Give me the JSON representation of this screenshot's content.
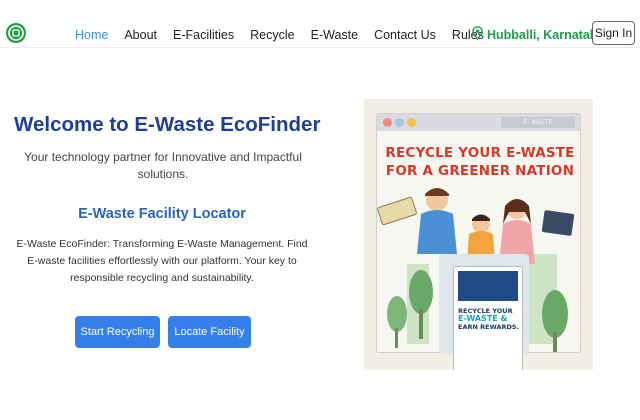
{
  "nav": {
    "links": [
      {
        "label": "Home",
        "active": true
      },
      {
        "label": "About",
        "active": false
      },
      {
        "label": "E-Facilities",
        "active": false
      },
      {
        "label": "Recycle",
        "active": false
      },
      {
        "label": "E-Waste",
        "active": false
      },
      {
        "label": "Contact Us",
        "active": false
      },
      {
        "label": "Rules",
        "active": false
      }
    ],
    "location": "Hubballi, Karnataka",
    "signin_label": "Sign In"
  },
  "hero": {
    "title": "Welcome to E-Waste EcoFinder",
    "subtitle": "Your technology partner for Innovative and Impactful solutions.",
    "locator_title": "E-Waste Facility Locator",
    "description": "E-Waste EcoFinder: Transforming E-Waste Management. Find E-waste facilities effortlessly with our platform. Your key to responsible recycling and sustainability.",
    "buttons": {
      "recycle": "Start Recycling",
      "locate": "Locate Facility"
    }
  },
  "illustration": {
    "url_text": "E-WASTE",
    "headline_line1": "RECYCLE YOUR E-WASTE",
    "headline_line2": "FOR A GREENER NATION",
    "poster_line1": "RECYCLE YOUR",
    "poster_line2": "E-WASTE &",
    "poster_line3": "EARN REWARDS."
  },
  "colors": {
    "brand_green": "#1f9d4b",
    "title_blue": "#1f3f96",
    "button_blue": "#3580e8",
    "active_link": "#3d8fd9",
    "headline_red": "#d43a2a"
  },
  "icons": {
    "logo": "recycle-logo-icon",
    "location": "map-pin-icon"
  }
}
